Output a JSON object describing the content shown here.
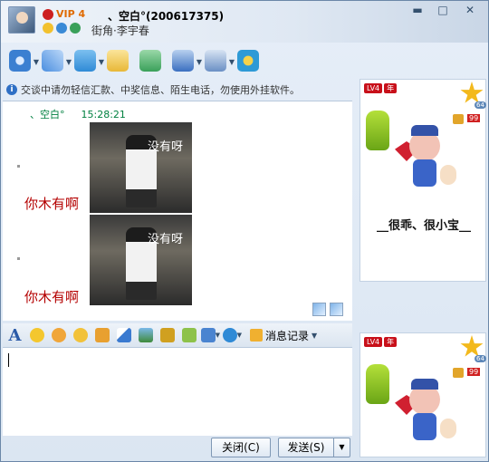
{
  "window": {
    "vip_label": "VIP 4",
    "nickname": "、空白°(200617375)",
    "signature": "街角·李宇春",
    "minimize": "▬",
    "maximize": "□",
    "close": "✕"
  },
  "toolbar": {
    "items": [
      {
        "name": "video-call",
        "icon": "webcam-icon",
        "color": "#3b7fd1"
      },
      {
        "name": "voice-call",
        "icon": "microphone-icon",
        "color": "#4a8ee0"
      },
      {
        "name": "send-file",
        "icon": "folder-icon",
        "color": "#2f8ad6"
      },
      {
        "name": "send-sms",
        "icon": "sms-icon",
        "color": "#e8b838"
      },
      {
        "name": "create-discussion",
        "icon": "add-group-icon",
        "color": "#3aa05a"
      },
      {
        "name": "remote-assist",
        "icon": "remote-icon",
        "color": "#3a6fc0"
      },
      {
        "name": "apps",
        "icon": "apps-icon",
        "color": "#6a8fc4"
      },
      {
        "name": "qzone",
        "icon": "qzone-icon",
        "color": "#2e9ad6"
      }
    ]
  },
  "notice": "交谈中请勿轻信汇款、中奖信息、陌生电话，勿使用外挂软件。",
  "messages": {
    "sender": "、空白°",
    "time": "15:28:21",
    "photo_caption": "没有呀",
    "red_caption": "你木有啊"
  },
  "input_toolbar": {
    "font_label": "A",
    "history_label": "消息记录"
  },
  "buttons": {
    "close": "关闭(C)",
    "send": "发送(S)",
    "send_dropdown": "▼"
  },
  "side_panel": {
    "level": "LV4",
    "year": "年",
    "star_count": "64",
    "badge": "99",
    "show_text": "__很乖、很小宝__"
  }
}
